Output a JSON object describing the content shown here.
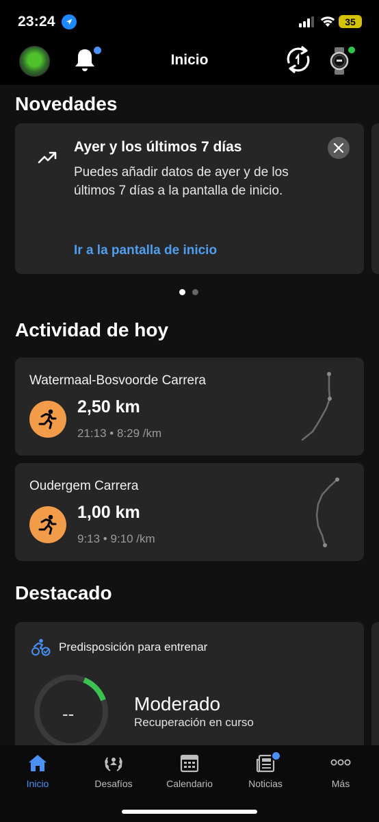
{
  "status_bar": {
    "time": "23:24",
    "battery": "35"
  },
  "nav": {
    "title": "Inicio"
  },
  "news": {
    "section_title": "Novedades",
    "card": {
      "title": "Ayer y los últimos 7 días",
      "body": "Puedes añadir datos de ayer y de los últimos 7 días a la pantalla de inicio.",
      "link": "Ir a la pantalla de inicio"
    },
    "page_count": 2,
    "active_page": 1
  },
  "activity": {
    "section_title": "Actividad de hoy",
    "items": [
      {
        "name": "Watermaal-Bosvoorde Carrera",
        "distance": "2,50 km",
        "meta": "21:13 • 8:29 /km"
      },
      {
        "name": "Oudergem Carrera",
        "distance": "1,00 km",
        "meta": "9:13 • 9:10 /km"
      }
    ]
  },
  "featured": {
    "section_title": "Destacado",
    "card": {
      "label": "Predisposición para entrenar",
      "value": "--",
      "status": "Moderado",
      "substatus": "Recuperación en curso"
    }
  },
  "tabs": [
    {
      "label": "Inicio",
      "icon": "home-icon",
      "active": true
    },
    {
      "label": "Desafíos",
      "icon": "laurel-icon",
      "active": false
    },
    {
      "label": "Calendario",
      "icon": "calendar-icon",
      "active": false
    },
    {
      "label": "Noticias",
      "icon": "newspaper-icon",
      "active": false
    },
    {
      "label": "Más",
      "icon": "more-icon",
      "active": false
    }
  ],
  "colors": {
    "accent": "#4a90f5",
    "link": "#4f9ef0",
    "run_badge": "#f29c4a",
    "gauge_fill": "#3cc151",
    "card_bg": "#262626"
  }
}
